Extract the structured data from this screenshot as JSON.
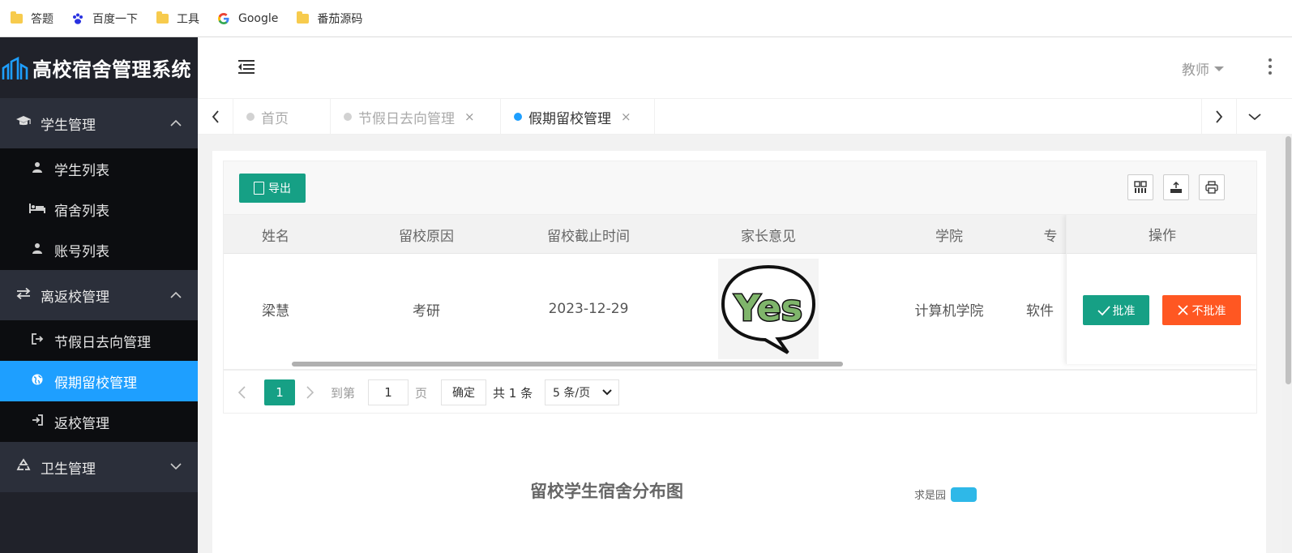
{
  "bookmarks": [
    {
      "label": "答题",
      "icon": "folder-icon"
    },
    {
      "label": "百度一下",
      "icon": "baidu-icon"
    },
    {
      "label": "工具",
      "icon": "folder-icon"
    },
    {
      "label": "Google",
      "icon": "google-icon"
    },
    {
      "label": "番茄源码",
      "icon": "folder-icon"
    }
  ],
  "app": {
    "title": "高校宿舍管理系统"
  },
  "sidebar": {
    "groups": [
      {
        "label": "学生管理",
        "items": [
          {
            "label": "学生列表"
          },
          {
            "label": "宿舍列表"
          },
          {
            "label": "账号列表"
          }
        ]
      },
      {
        "label": "离返校管理",
        "items": [
          {
            "label": "节假日去向管理"
          },
          {
            "label": "假期留校管理"
          },
          {
            "label": "返校管理"
          }
        ]
      },
      {
        "label": "卫生管理"
      }
    ]
  },
  "header": {
    "user_label": "教师"
  },
  "tabs": [
    {
      "label": "首页"
    },
    {
      "label": "节假日去向管理",
      "close": "×"
    },
    {
      "label": "假期留校管理",
      "close": "×"
    }
  ],
  "toolbar": {
    "export_label": "导出"
  },
  "table": {
    "columns": [
      "姓名",
      "留校原因",
      "留校截止时间",
      "家长意见",
      "学院",
      "专",
      "操作"
    ],
    "rows": [
      {
        "name": "梁慧",
        "reason": "考研",
        "deadline": "2023-12-29",
        "opinion_image_text": "Yes",
        "college": "计算机学院",
        "major_partial": "软件"
      }
    ],
    "approve_label": "批准",
    "reject_label": "不批准"
  },
  "pager": {
    "current_page": "1",
    "goto_label": "到第",
    "goto_value": "1",
    "page_unit": "页",
    "confirm_label": "确定",
    "total_label": "共 1 条",
    "page_size": "5 条/页"
  },
  "chart": {
    "title": "留校学生宿舍分布图",
    "legend_label": "求是园",
    "legend_color": "#2eb8e8"
  },
  "colors": {
    "accent": "#1e9fff",
    "primary_button": "#16a085",
    "danger_button": "#ff5722",
    "sidebar": "#20222a"
  }
}
